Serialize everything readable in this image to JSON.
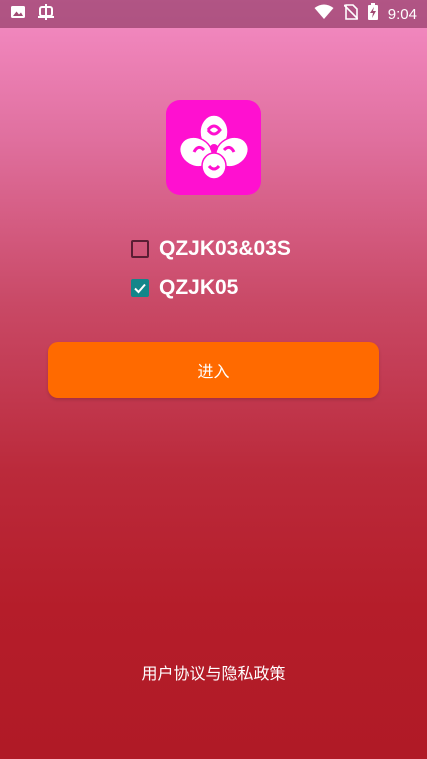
{
  "status_bar": {
    "time": "9:04",
    "left_icons": [
      "image-icon",
      "bug-icon"
    ],
    "right_icons": [
      "wifi-icon",
      "no-sim-icon",
      "battery-charging-icon"
    ]
  },
  "app": {
    "logo_icon": "flower-logo-icon",
    "logo_color": "#ff10d0"
  },
  "options": [
    {
      "label": "QZJK03&03S",
      "checked": false
    },
    {
      "label": "QZJK05",
      "checked": true
    }
  ],
  "enter_button": {
    "label": "进入",
    "color": "#ff6a00"
  },
  "policy_link": {
    "label": "用户协议与隐私政策"
  },
  "colors": {
    "checkbox_checked": "#13868a"
  }
}
